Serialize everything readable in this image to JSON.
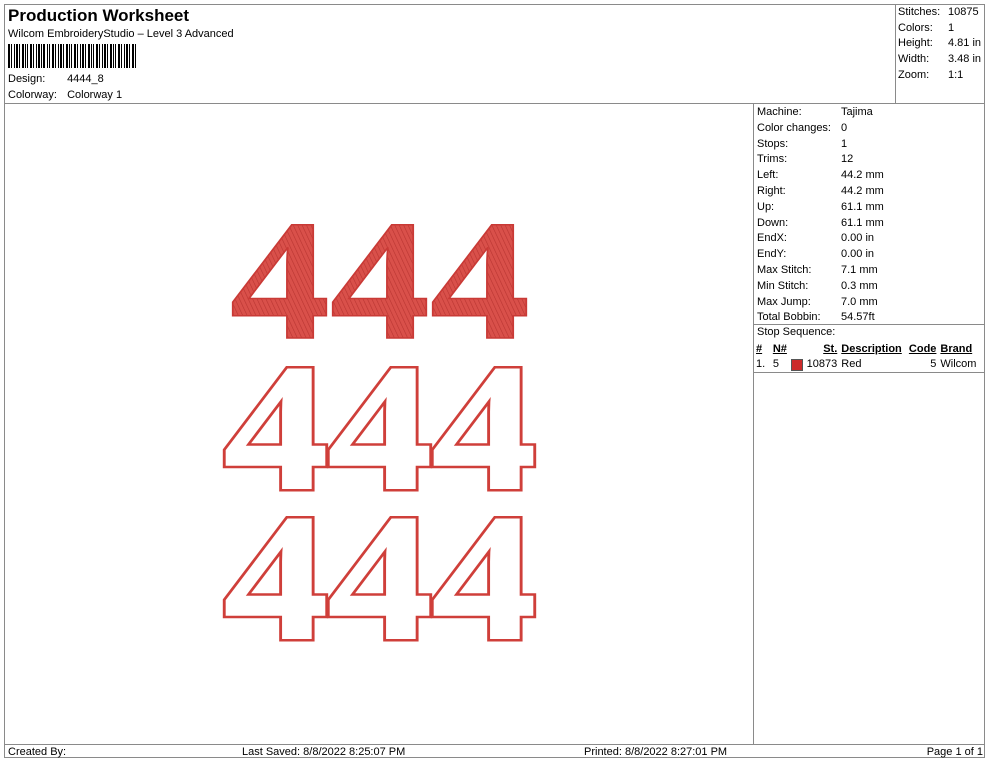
{
  "header": {
    "title": "Production Worksheet",
    "software": "Wilcom EmbroideryStudio – Level 3 Advanced",
    "design_label": "Design:",
    "design_value": "4444_8",
    "colorway_label": "Colorway:",
    "colorway_value": "Colorway 1"
  },
  "summary": [
    {
      "label": "Stitches:",
      "value": "10875"
    },
    {
      "label": "Colors:",
      "value": "1"
    },
    {
      "label": "Height:",
      "value": "4.81 in"
    },
    {
      "label": "Width:",
      "value": "3.48 in"
    },
    {
      "label": "Zoom:",
      "value": "1:1"
    }
  ],
  "properties": [
    {
      "label": "Machine:",
      "value": "Tajima"
    },
    {
      "label": "Color changes:",
      "value": "0"
    },
    {
      "label": "Stops:",
      "value": "1"
    },
    {
      "label": "Trims:",
      "value": "12"
    },
    {
      "label": "Left:",
      "value": "44.2 mm"
    },
    {
      "label": "Right:",
      "value": "44.2 mm"
    },
    {
      "label": "Up:",
      "value": "61.1 mm"
    },
    {
      "label": "Down:",
      "value": "61.1 mm"
    },
    {
      "label": "EndX:",
      "value": "0.00 in"
    },
    {
      "label": "EndY:",
      "value": "0.00 in"
    },
    {
      "label": "Max Stitch:",
      "value": "7.1 mm"
    },
    {
      "label": "Min Stitch:",
      "value": "0.3 mm"
    },
    {
      "label": "Max Jump:",
      "value": "7.0 mm"
    },
    {
      "label": "Total Bobbin:",
      "value": "54.57ft"
    }
  ],
  "stop_sequence": {
    "title": "Stop Sequence:",
    "headers": {
      "idx": "#",
      "n": "N#",
      "st": "St.",
      "description": "Description",
      "code": "Code",
      "brand": "Brand"
    },
    "rows": [
      {
        "idx": "1.",
        "n": "5",
        "color": "#cc2a2a",
        "st": "10873",
        "description": "Red",
        "code": "5",
        "brand": "Wilcom"
      }
    ]
  },
  "design_preview": {
    "lines": [
      "444",
      "444",
      "444"
    ],
    "fill_color": "#d9504a",
    "outline_color": "#cf3f3a"
  },
  "footer": {
    "created_by": "Created By:",
    "last_saved": "Last Saved: 8/8/2022 8:25:07 PM",
    "printed": "Printed: 8/8/2022 8:27:01 PM",
    "page": "Page 1 of 1"
  }
}
